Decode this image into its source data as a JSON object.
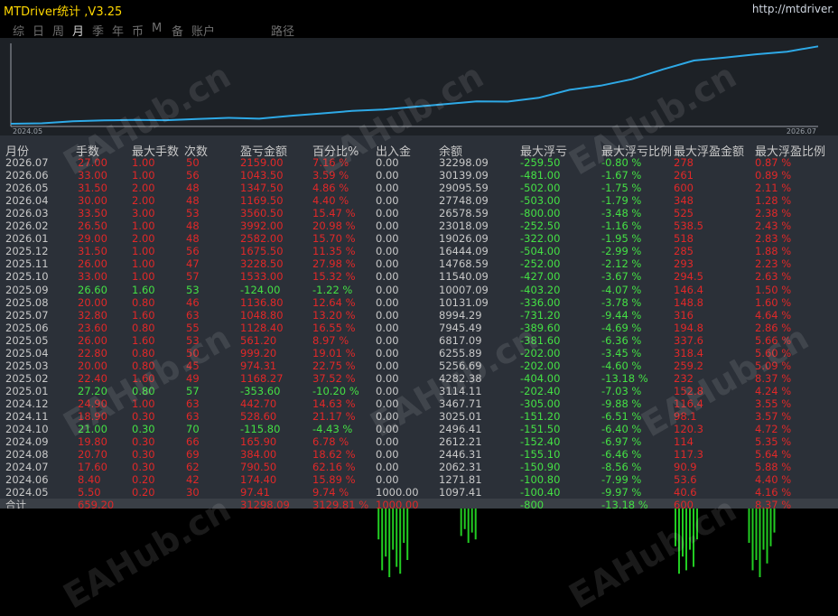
{
  "app": {
    "title": "MTDriver统计 ,V3.25",
    "url": "http://mtdriver."
  },
  "tabs": [
    {
      "label": "综",
      "active": false
    },
    {
      "label": "日",
      "active": false
    },
    {
      "label": "周",
      "active": false
    },
    {
      "label": "月",
      "active": true
    },
    {
      "label": "季",
      "active": false
    },
    {
      "label": "年",
      "active": false
    },
    {
      "label": "币",
      "active": false
    },
    {
      "label": "M",
      "active": false
    },
    {
      "label": "备",
      "active": false
    },
    {
      "label": "账户",
      "active": false
    },
    {
      "label": "路径",
      "active": false
    }
  ],
  "chart_data": {
    "type": "line",
    "x_start_label": "2024.05",
    "x_end_label": "2026.07",
    "x": [
      "2024.05",
      "2024.06",
      "2024.07",
      "2024.08",
      "2024.09",
      "2024.10",
      "2024.11",
      "2024.12",
      "2025.01",
      "2025.02",
      "2025.03",
      "2025.04",
      "2025.05",
      "2025.06",
      "2025.07",
      "2025.08",
      "2025.09",
      "2025.10",
      "2025.11",
      "2025.12",
      "2026.01",
      "2026.02",
      "2026.03",
      "2026.04",
      "2026.05",
      "2026.06",
      "2026.07"
    ],
    "values": [
      1097.41,
      1271.81,
      2062.31,
      2446.31,
      2612.21,
      2496.41,
      3025.01,
      3467.71,
      3114.11,
      4282.38,
      5256.69,
      6255.89,
      6817.09,
      7945.49,
      8994.29,
      10131.09,
      10007.09,
      11540.09,
      14768.59,
      16444.09,
      19026.09,
      23018.09,
      26578.59,
      27748.09,
      29095.59,
      30139.09,
      32298.09
    ],
    "line_color": "#2ea9e6"
  },
  "table": {
    "headers": [
      "月份",
      "手数",
      "最大手数",
      "次数",
      "盈亏金额",
      "百分比%",
      "出入金",
      "余额",
      "最大浮亏",
      "最大浮亏比例",
      "最大浮盈金额",
      "最大浮盈比例"
    ],
    "rows": [
      [
        "2026.07",
        "27.00",
        "1.00",
        "50",
        "2159.00",
        "7.16 %",
        "0.00",
        "32298.09",
        "-259.50",
        "-0.80 %",
        "278",
        "0.87 %"
      ],
      [
        "2026.06",
        "33.00",
        "1.00",
        "56",
        "1043.50",
        "3.59 %",
        "0.00",
        "30139.09",
        "-481.00",
        "-1.67 %",
        "261",
        "0.89 %"
      ],
      [
        "2026.05",
        "31.50",
        "2.00",
        "48",
        "1347.50",
        "4.86 %",
        "0.00",
        "29095.59",
        "-502.00",
        "-1.75 %",
        "600",
        "2.11 %"
      ],
      [
        "2026.04",
        "30.00",
        "2.00",
        "48",
        "1169.50",
        "4.40 %",
        "0.00",
        "27748.09",
        "-503.00",
        "-1.79 %",
        "348",
        "1.28 %"
      ],
      [
        "2026.03",
        "33.50",
        "3.00",
        "53",
        "3560.50",
        "15.47 %",
        "0.00",
        "26578.59",
        "-800.00",
        "-3.48 %",
        "525",
        "2.38 %"
      ],
      [
        "2026.02",
        "26.50",
        "1.00",
        "48",
        "3992.00",
        "20.98 %",
        "0.00",
        "23018.09",
        "-252.50",
        "-1.16 %",
        "538.5",
        "2.43 %"
      ],
      [
        "2026.01",
        "29.00",
        "2.00",
        "48",
        "2582.00",
        "15.70 %",
        "0.00",
        "19026.09",
        "-322.00",
        "-1.95 %",
        "518",
        "2.83 %"
      ],
      [
        "2025.12",
        "31.50",
        "1.00",
        "56",
        "1675.50",
        "11.35 %",
        "0.00",
        "16444.09",
        "-504.00",
        "-2.99 %",
        "285",
        "1.88 %"
      ],
      [
        "2025.11",
        "26.00",
        "1.00",
        "47",
        "3228.50",
        "27.98 %",
        "0.00",
        "14768.59",
        "-252.00",
        "-2.12 %",
        "293",
        "2.23 %"
      ],
      [
        "2025.10",
        "33.00",
        "1.00",
        "57",
        "1533.00",
        "15.32 %",
        "0.00",
        "11540.09",
        "-427.00",
        "-3.67 %",
        "294.5",
        "2.63 %"
      ],
      [
        "2025.09",
        "26.60",
        "1.60",
        "53",
        "-124.00",
        "-1.22 %",
        "0.00",
        "10007.09",
        "-403.20",
        "-4.07 %",
        "146.4",
        "1.50 %"
      ],
      [
        "2025.08",
        "20.00",
        "0.80",
        "46",
        "1136.80",
        "12.64 %",
        "0.00",
        "10131.09",
        "-336.00",
        "-3.78 %",
        "148.8",
        "1.60 %"
      ],
      [
        "2025.07",
        "32.80",
        "1.60",
        "63",
        "1048.80",
        "13.20 %",
        "0.00",
        "8994.29",
        "-731.20",
        "-9.44 %",
        "316",
        "4.64 %"
      ],
      [
        "2025.06",
        "23.60",
        "0.80",
        "55",
        "1128.40",
        "16.55 %",
        "0.00",
        "7945.49",
        "-389.60",
        "-4.69 %",
        "194.8",
        "2.86 %"
      ],
      [
        "2025.05",
        "26.00",
        "1.60",
        "53",
        "561.20",
        "8.97 %",
        "0.00",
        "6817.09",
        "-381.60",
        "-6.36 %",
        "337.6",
        "5.66 %"
      ],
      [
        "2025.04",
        "22.80",
        "0.80",
        "50",
        "999.20",
        "19.01 %",
        "0.00",
        "6255.89",
        "-202.00",
        "-3.45 %",
        "318.4",
        "5.60 %"
      ],
      [
        "2025.03",
        "20.00",
        "0.80",
        "45",
        "974.31",
        "22.75 %",
        "0.00",
        "5256.69",
        "-202.00",
        "-4.60 %",
        "259.2",
        "5.09 %"
      ],
      [
        "2025.02",
        "22.40",
        "1.60",
        "49",
        "1168.27",
        "37.52 %",
        "0.00",
        "4282.38",
        "-404.00",
        "-13.18 %",
        "232",
        "8.37 %"
      ],
      [
        "2025.01",
        "27.20",
        "0.80",
        "57",
        "-353.60",
        "-10.20 %",
        "0.00",
        "3114.11",
        "-202.40",
        "-7.03 %",
        "152.8",
        "4.24 %"
      ],
      [
        "2024.12",
        "24.90",
        "1.00",
        "63",
        "442.70",
        "14.63 %",
        "0.00",
        "3467.71",
        "-305.00",
        "-9.88 %",
        "116.4",
        "3.55 %"
      ],
      [
        "2024.11",
        "18.90",
        "0.30",
        "63",
        "528.60",
        "21.17 %",
        "0.00",
        "3025.01",
        "-151.20",
        "-6.51 %",
        "98.1",
        "3.57 %"
      ],
      [
        "2024.10",
        "21.00",
        "0.30",
        "70",
        "-115.80",
        "-4.43 %",
        "0.00",
        "2496.41",
        "-151.50",
        "-6.40 %",
        "120.3",
        "4.72 %"
      ],
      [
        "2024.09",
        "19.80",
        "0.30",
        "66",
        "165.90",
        "6.78 %",
        "0.00",
        "2612.21",
        "-152.40",
        "-6.97 %",
        "114",
        "5.35 %"
      ],
      [
        "2024.08",
        "20.70",
        "0.30",
        "69",
        "384.00",
        "18.62 %",
        "0.00",
        "2446.31",
        "-155.10",
        "-6.46 %",
        "117.3",
        "5.64 %"
      ],
      [
        "2024.07",
        "17.60",
        "0.30",
        "62",
        "790.50",
        "62.16 %",
        "0.00",
        "2062.31",
        "-150.90",
        "-8.56 %",
        "90.9",
        "5.88 %"
      ],
      [
        "2024.06",
        "8.40",
        "0.20",
        "42",
        "174.40",
        "15.89 %",
        "0.00",
        "1271.81",
        "-100.80",
        "-7.99 %",
        "53.6",
        "4.40 %"
      ],
      [
        "2024.05",
        "5.50",
        "0.20",
        "30",
        "97.41",
        "9.74 %",
        "1000.00",
        "1097.41",
        "-100.40",
        "-9.97 %",
        "40.6",
        "4.16 %"
      ]
    ],
    "total": [
      "合计",
      "659.20",
      "",
      "",
      "31298.09",
      "3129.81 %",
      "1000.00",
      "",
      "-800",
      "-13.18 %",
      "600",
      "8.37 %"
    ]
  },
  "bottom_bars": {
    "color": "#22cc22",
    "groups": [
      {
        "center_pct": 47,
        "heights": [
          0.45,
          0.9,
          0.7,
          1.0,
          0.6,
          0.85,
          0.95,
          0.5,
          0.75
        ]
      },
      {
        "center_pct": 56,
        "heights": [
          0.4,
          0.3,
          0.5,
          0.35,
          0.45
        ]
      },
      {
        "center_pct": 82,
        "heights": [
          0.55,
          0.95,
          0.7,
          0.9,
          0.6,
          0.85,
          0.45
        ]
      },
      {
        "center_pct": 91,
        "heights": [
          0.5,
          0.9,
          0.75,
          1.0,
          0.6,
          0.8,
          0.55,
          0.35
        ]
      }
    ]
  },
  "watermark": "EAHub.cn"
}
